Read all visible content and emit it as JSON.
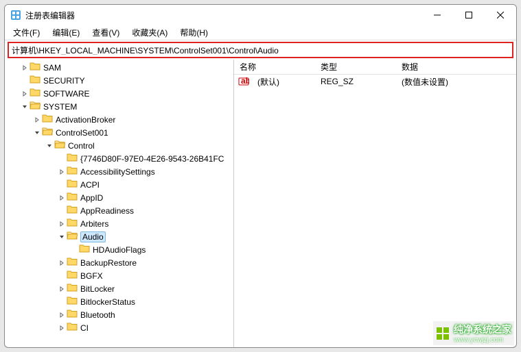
{
  "window": {
    "title": "注册表编辑器"
  },
  "menus": {
    "file": "文件(F)",
    "edit": "编辑(E)",
    "view": "查看(V)",
    "fav": "收藏夹(A)",
    "help": "帮助(H)"
  },
  "address": "计算机\\HKEY_LOCAL_MACHINE\\SYSTEM\\ControlSet001\\Control\\Audio",
  "tree": [
    {
      "depth": 1,
      "exp": "closed",
      "label": "SAM"
    },
    {
      "depth": 1,
      "exp": "none",
      "label": "SECURITY"
    },
    {
      "depth": 1,
      "exp": "closed",
      "label": "SOFTWARE"
    },
    {
      "depth": 1,
      "exp": "open",
      "label": "SYSTEM"
    },
    {
      "depth": 2,
      "exp": "closed",
      "label": "ActivationBroker"
    },
    {
      "depth": 2,
      "exp": "open",
      "label": "ControlSet001"
    },
    {
      "depth": 3,
      "exp": "open",
      "label": "Control"
    },
    {
      "depth": 4,
      "exp": "none",
      "label": "{7746D80F-97E0-4E26-9543-26B41FC"
    },
    {
      "depth": 4,
      "exp": "closed",
      "label": "AccessibilitySettings"
    },
    {
      "depth": 4,
      "exp": "none",
      "label": "ACPI"
    },
    {
      "depth": 4,
      "exp": "closed",
      "label": "AppID"
    },
    {
      "depth": 4,
      "exp": "none",
      "label": "AppReadiness"
    },
    {
      "depth": 4,
      "exp": "closed",
      "label": "Arbiters"
    },
    {
      "depth": 4,
      "exp": "open",
      "label": "Audio",
      "selected": true
    },
    {
      "depth": 5,
      "exp": "none",
      "label": "HDAudioFlags"
    },
    {
      "depth": 4,
      "exp": "closed",
      "label": "BackupRestore"
    },
    {
      "depth": 4,
      "exp": "none",
      "label": "BGFX"
    },
    {
      "depth": 4,
      "exp": "closed",
      "label": "BitLocker"
    },
    {
      "depth": 4,
      "exp": "none",
      "label": "BitlockerStatus"
    },
    {
      "depth": 4,
      "exp": "closed",
      "label": "Bluetooth"
    },
    {
      "depth": 4,
      "exp": "closed",
      "label": "CI"
    }
  ],
  "listhead": {
    "name": "名称",
    "type": "类型",
    "data": "数据"
  },
  "values": [
    {
      "name": "(默认)",
      "type": "REG_SZ",
      "data": "(数值未设置)"
    }
  ],
  "watermark": {
    "brand": "纯净系统之家",
    "url": "www.ycwjzj.com"
  }
}
